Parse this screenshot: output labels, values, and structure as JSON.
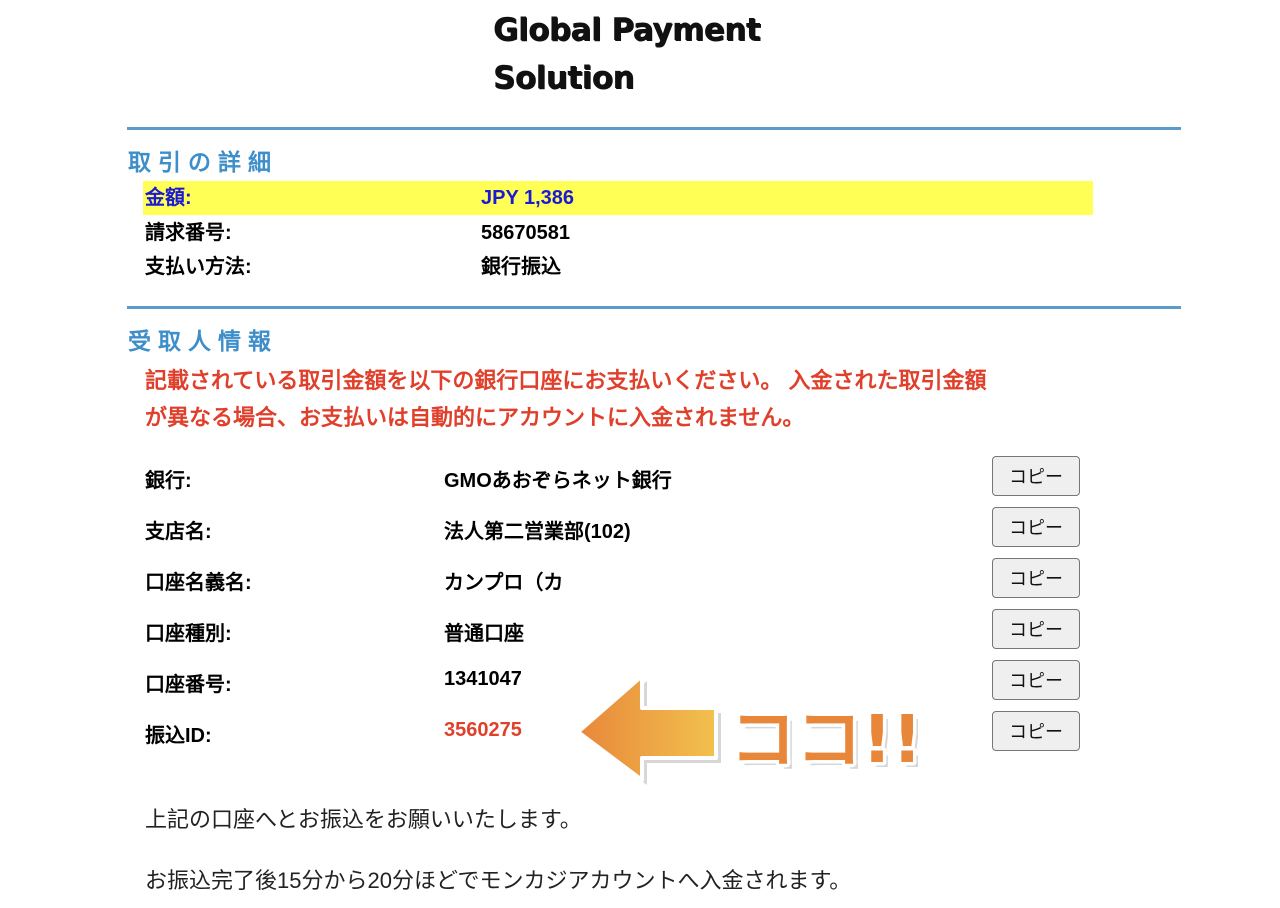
{
  "logo": {
    "line1": "Global Payment",
    "line2": "Solution"
  },
  "transaction": {
    "section_title": "取引の詳細",
    "amount_label": "金額:",
    "amount_value": "JPY 1,386",
    "invoice_label": "請求番号:",
    "invoice_value": "58670581",
    "method_label": "支払い方法:",
    "method_value": "銀行振込"
  },
  "recipient": {
    "section_title": "受取人情報",
    "notice_line1": "記載されている取引金額を以下の銀行口座にお支払いください。 入金された取引金額",
    "notice_line2": "が異なる場合、お支払いは自動的にアカウントに入金されません。",
    "copy_label": "コピー",
    "rows": [
      {
        "label": "銀行:",
        "value": "GMOあおぞらネット銀行"
      },
      {
        "label": "支店名:",
        "value": "法人第二営業部(102)"
      },
      {
        "label": "口座名義名:",
        "value": "カンプロ（カ"
      },
      {
        "label": "口座種別:",
        "value": "普通口座"
      },
      {
        "label": "口座番号:",
        "value": "1341047"
      },
      {
        "label": "振込ID:",
        "value": "3560275"
      }
    ]
  },
  "annotation": {
    "text": "ココ!!",
    "color": "#e8873a"
  },
  "footer": {
    "line1": "上記の口座へとお振込をお願いいたします。",
    "line2": "お振込完了後15分から20分ほどでモンカジアカウントへ入金されます。"
  },
  "colors": {
    "accent_blue": "#3d8ec9",
    "highlight_yellow": "#ffff55",
    "notice_red": "#e0402b"
  }
}
